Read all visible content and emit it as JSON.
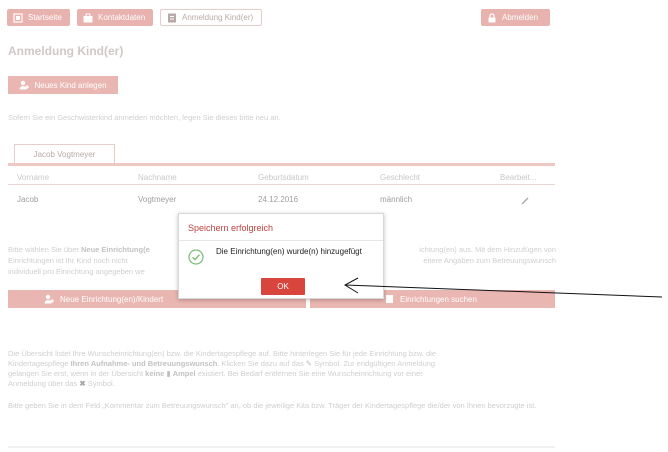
{
  "nav": {
    "startseite": "Startseite",
    "kontaktdaten": "Kontaktdaten",
    "anmeldung": "Anmeldung Kind(er)",
    "abmelden": "Abmelden"
  },
  "page_title": "Anmeldung Kind(er)",
  "new_child_button": "Neues Kind anlegen",
  "sibling_hint": "Sofern Sie ein Geschwisterkind anmelden möchten, legen Sie dieses bitte neu an.",
  "child_tab": "Jacob Vogtmeyer",
  "table": {
    "headers": [
      "Vorname",
      "Nachname",
      "Geburtsdatum",
      "Geschlecht",
      "Bearbeit..."
    ],
    "row": [
      "Jacob",
      "Vogtmeyer",
      "24.12.2016",
      "männlich"
    ]
  },
  "info_text": {
    "line1_left": "Bitte wählen Sie über",
    "line1_bold": "Neue Einrichtung(e",
    "line1_right": "ichtung(en) aus. Mit dem Hinzufügen von",
    "line2_left": "Einrichtungen ist Ihr Kind noch nicht",
    "line2_right": "eitere Angaben zum Betreuungswunsch",
    "line3": "individuell pro Einrichtung angegeben we"
  },
  "buttons": {
    "add_institution": "Neue Einrichtung(en)/Kindert",
    "search_institutions": "Einrichtungen suchen"
  },
  "overview_text": {
    "l1": "Die Übersicht listet Ihre Wunscheinrichtung(en) bzw. die Kindertagespflege auf. Bitte hinterlegen Sie für jede Einrichtung bzw. die",
    "l2a": "Kindertagespflege",
    "l2b": "Ihren Aufnahme- und Betreuungswunsch",
    "l2c": ". Klicken Sie dazu auf das",
    "l2d": "Symbol. Zur endgültigen Anmeldung",
    "l3a": "gelangen Sie erst, wenn in der Übersicht",
    "l3b": "keine",
    "l3c": "Ampel",
    "l3d": "existiert. Bei Bedarf entfernen Sie eine Wunscheinrichtung vor einer",
    "l4a": "Anmeldung über das",
    "l4b": "Symbol."
  },
  "comment_text": "Bitte geben Sie in dem Feld „Kommentar zum Betreuungswunsch\" an, ob die jeweilige Kita bzw. Träger der Kindertagespflege die/der von Ihnen bevorzugte ist.",
  "modal": {
    "title": "Speichern erfolgreich",
    "message": "Die Einrichtung(en) wurde(n) hinzugefügt",
    "ok": "OK"
  },
  "colors": {
    "accent": "#e8b2ae",
    "ok_button": "#d8453d",
    "modal_title": "#c0423d",
    "success_check": "#7ec07a"
  }
}
